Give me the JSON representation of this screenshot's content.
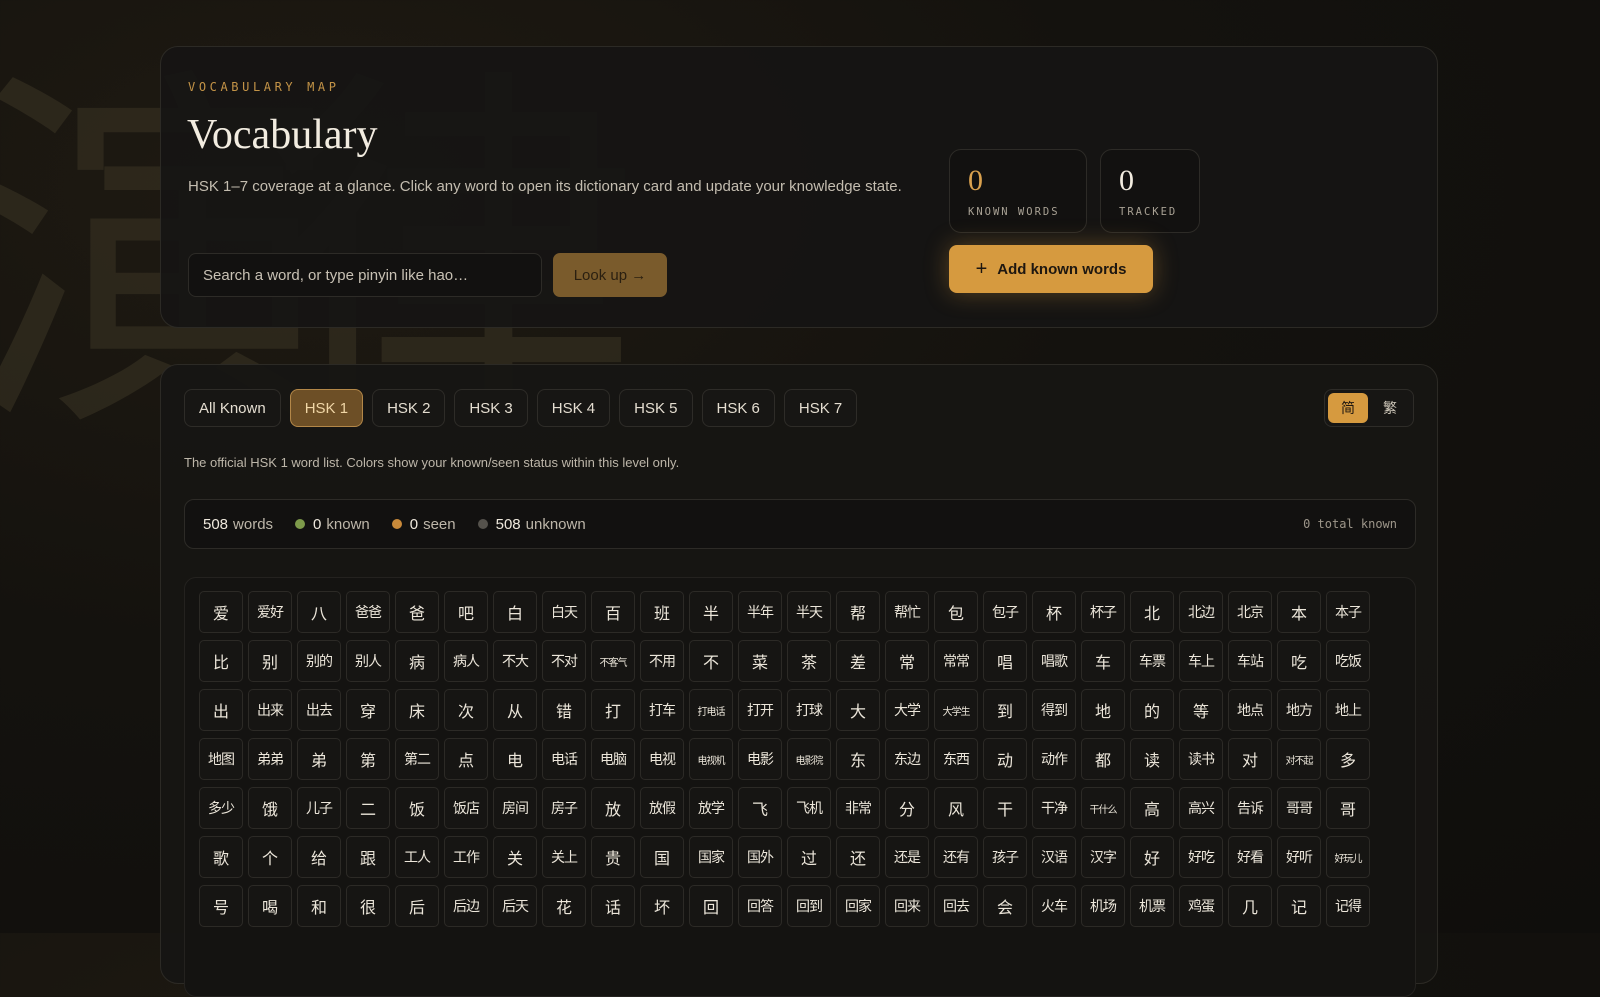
{
  "header": {
    "eyebrow": "VOCABULARY MAP",
    "title": "Vocabulary",
    "description": "HSK 1–7 coverage at a glance. Click any word to open its dictionary card and update your knowledge state.",
    "search_placeholder": "Search a word, or type pinyin like hao…",
    "lookup_label": "Look up →",
    "stats": {
      "known_value": "0",
      "known_label": "KNOWN WORDS",
      "tracked_value": "0",
      "tracked_label": "TRACKED"
    },
    "add_known_label": "Add known words"
  },
  "tabs": [
    {
      "label": "All Known",
      "active": false
    },
    {
      "label": "HSK 1",
      "active": true
    },
    {
      "label": "HSK 2",
      "active": false
    },
    {
      "label": "HSK 3",
      "active": false
    },
    {
      "label": "HSK 4",
      "active": false
    },
    {
      "label": "HSK 5",
      "active": false
    },
    {
      "label": "HSK 6",
      "active": false
    },
    {
      "label": "HSK 7",
      "active": false
    }
  ],
  "script_toggle": {
    "simplified": "简",
    "traditional": "繁",
    "selected": "simplified"
  },
  "hint": "The official HSK 1 word list. Colors show your known/seen status within this level only.",
  "summary": {
    "words_count": "508",
    "words_label": "words",
    "known_count": "0",
    "known_label": "known",
    "seen_count": "0",
    "seen_label": "seen",
    "unknown_count": "508",
    "unknown_label": "unknown",
    "total_known": "0 total known"
  },
  "colors": {
    "accent": "#d69a3f",
    "known_dot": "#7d9a4a",
    "seen_dot": "#c98a3a",
    "unknown_dot": "#55524c"
  },
  "icons": {
    "add": "plus-icon"
  },
  "words": [
    "爱",
    "爱好",
    "八",
    "爸爸",
    "爸",
    "吧",
    "白",
    "白天",
    "百",
    "班",
    "半",
    "半年",
    "半天",
    "帮",
    "帮忙",
    "包",
    "包子",
    "杯",
    "杯子",
    "北",
    "北边",
    "北京",
    "本",
    "本子",
    "比",
    "别",
    "别的",
    "别人",
    "病",
    "病人",
    "不大",
    "不对",
    "不客气",
    "不用",
    "不",
    "菜",
    "茶",
    "差",
    "常",
    "常常",
    "唱",
    "唱歌",
    "车",
    "车票",
    "车上",
    "车站",
    "吃",
    "吃饭",
    "出",
    "出来",
    "出去",
    "穿",
    "床",
    "次",
    "从",
    "错",
    "打",
    "打车",
    "打电话",
    "打开",
    "打球",
    "大",
    "大学",
    "大学生",
    "到",
    "得到",
    "地",
    "的",
    "等",
    "地点",
    "地方",
    "地上",
    "地图",
    "弟弟",
    "弟",
    "第",
    "第二",
    "点",
    "电",
    "电话",
    "电脑",
    "电视",
    "电视机",
    "电影",
    "电影院",
    "东",
    "东边",
    "东西",
    "动",
    "动作",
    "都",
    "读",
    "读书",
    "对",
    "对不起",
    "多",
    "多少",
    "饿",
    "儿子",
    "二",
    "饭",
    "饭店",
    "房间",
    "房子",
    "放",
    "放假",
    "放学",
    "飞",
    "飞机",
    "非常",
    "分",
    "风",
    "干",
    "干净",
    "干什么",
    "高",
    "高兴",
    "告诉",
    "哥哥",
    "哥",
    "歌",
    "个",
    "给",
    "跟",
    "工人",
    "工作",
    "关",
    "关上",
    "贵",
    "国",
    "国家",
    "国外",
    "过",
    "还",
    "还是",
    "还有",
    "孩子",
    "汉语",
    "汉字",
    "好",
    "好吃",
    "好看",
    "好听",
    "好玩儿",
    "号",
    "喝",
    "和",
    "很",
    "后",
    "后边",
    "后天",
    "花",
    "话",
    "坏",
    "回",
    "回答",
    "回到",
    "回家",
    "回来",
    "回去",
    "会",
    "火车",
    "机场",
    "机票",
    "鸡蛋",
    "几",
    "记",
    "记得"
  ]
}
